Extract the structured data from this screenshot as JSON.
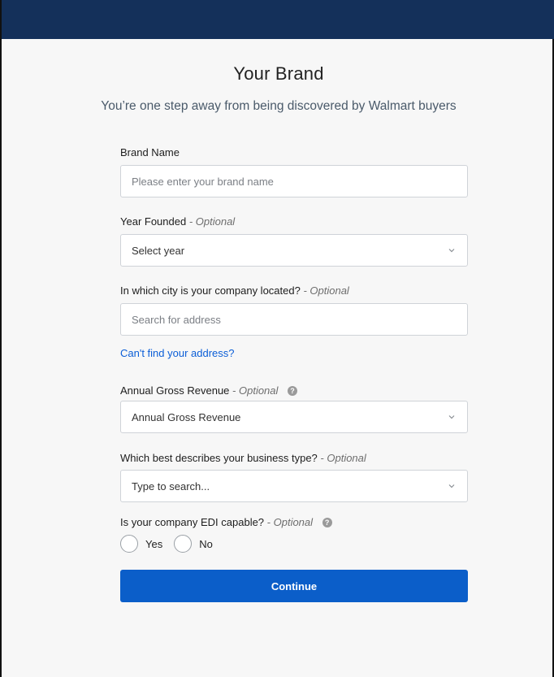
{
  "header": {
    "title": "Your Brand",
    "subtitle": "You’re one step away from being discovered by Walmart buyers"
  },
  "form": {
    "brand_name": {
      "label": "Brand Name",
      "placeholder": "Please enter your brand name",
      "value": ""
    },
    "year_founded": {
      "label": "Year Founded",
      "optional": "- Optional",
      "selected": "Select year"
    },
    "city": {
      "label": "In which city is your company located?",
      "optional": "- Optional",
      "placeholder": "Search for address",
      "value": ""
    },
    "cant_find_link": "Can't find your address?",
    "revenue": {
      "label": "Annual Gross Revenue",
      "optional": "- Optional",
      "help_icon": "question-icon",
      "selected": "Annual Gross Revenue"
    },
    "business_type": {
      "label": "Which best describes your business type?",
      "optional": "- Optional",
      "selected": "Type to search..."
    },
    "edi": {
      "label": "Is your company EDI capable?",
      "optional": "- Optional",
      "help_icon": "question-icon",
      "options": [
        "Yes",
        "No"
      ]
    },
    "continue_label": "Continue"
  },
  "colors": {
    "top_bar": "#14305a",
    "primary_button": "#0b5ec9",
    "link": "#0b5ed7"
  }
}
